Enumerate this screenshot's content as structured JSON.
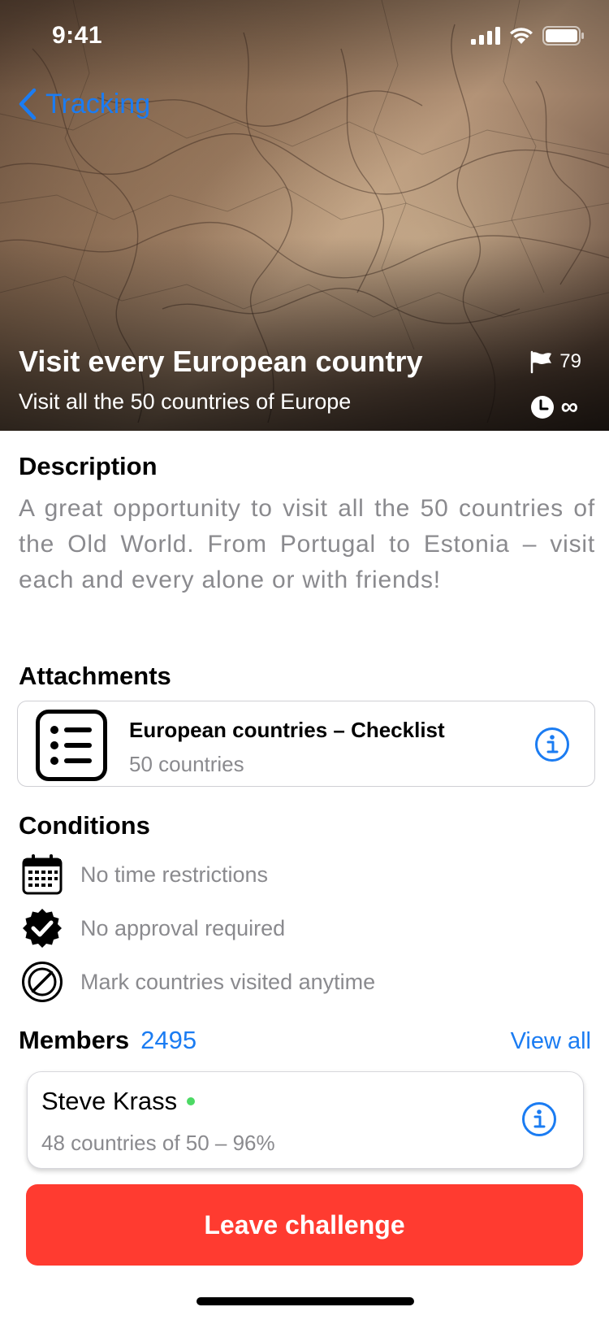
{
  "status_bar": {
    "time": "9:41",
    "icons": [
      "cellular-signal-icon",
      "wifi-icon",
      "battery-icon"
    ]
  },
  "nav": {
    "back_label": "Tracking",
    "back_icon": "chevron-left-icon"
  },
  "challenge": {
    "title": "Visit every European country",
    "subtitle": "Visit all the 50 countries of Europe",
    "flag_count": "79",
    "duration": "∞"
  },
  "description": {
    "heading": "Description",
    "text": "A great opportunity to visit all the 50 countries of the Old World. From Portugal to Estonia – visit each and every alone or with friends!"
  },
  "attachments": {
    "heading": "Attachments",
    "items": [
      {
        "title": "European countries – Checklist",
        "subtitle": "50 countries",
        "icon": "checklist-icon"
      }
    ]
  },
  "conditions": {
    "heading": "Conditions",
    "items": [
      {
        "label": "No time restrictions",
        "icon": "calendar-icon"
      },
      {
        "label": "No approval required",
        "icon": "verified-badge-icon"
      },
      {
        "label": "Mark countries visited anytime",
        "icon": "prohibited-icon"
      }
    ]
  },
  "members": {
    "heading": "Members",
    "count": "2495",
    "view_all": "View all",
    "items": [
      {
        "name": "Steve Krass",
        "online": true,
        "progress": "48 countries of 50 – 96%"
      }
    ]
  },
  "actions": {
    "leave_label": "Leave challenge"
  },
  "colors": {
    "accent": "#1b7cf2",
    "danger": "#ff3b30",
    "secondary_text": "#8a8a8e",
    "online": "#4cd964"
  }
}
